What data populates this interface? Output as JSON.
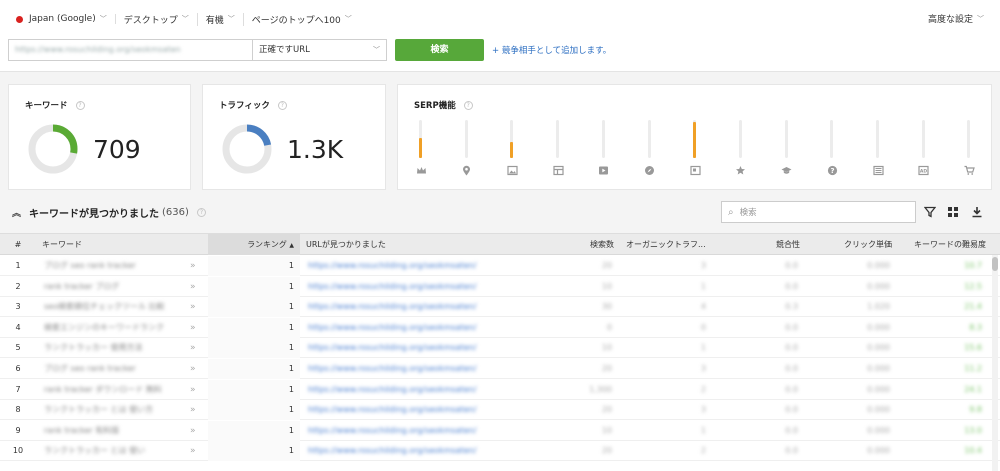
{
  "filters": [
    {
      "label": "Japan (Google)",
      "has_flag": true
    },
    {
      "label": "デスクトップ"
    },
    {
      "label": "有機"
    },
    {
      "label": "ページのトップへ100"
    }
  ],
  "advanced_settings": "高度な設定",
  "url_input": {
    "value": "https://www.rosuchilding.org/seokmsaten"
  },
  "match_mode": "正確ですURL",
  "search_button": "検索",
  "add_competitor": "+ 競争相手として追加します。",
  "cards": {
    "keywords": {
      "title": "キーワード",
      "value": "709",
      "fraction": 0.28,
      "color": "#5aaa35"
    },
    "traffic": {
      "title": "トラフィック",
      "value": "1.3K",
      "fraction": 0.22,
      "color": "#4a7fc1"
    },
    "serp": {
      "title": "SERP機能",
      "features": [
        {
          "icon": "crown-icon",
          "level": 0.55
        },
        {
          "icon": "map-pin-icon",
          "level": 0
        },
        {
          "icon": "image-icon",
          "level": 0.45
        },
        {
          "icon": "layout-icon",
          "level": 0
        },
        {
          "icon": "video-icon",
          "level": 0
        },
        {
          "icon": "compass-icon",
          "level": 0
        },
        {
          "icon": "featured-snippet-icon",
          "level": 1.0
        },
        {
          "icon": "star-icon",
          "level": 0
        },
        {
          "icon": "graduation-cap-icon",
          "level": 0
        },
        {
          "icon": "question-icon",
          "level": 0
        },
        {
          "icon": "news-icon",
          "level": 0
        },
        {
          "icon": "ad-icon",
          "level": 0
        },
        {
          "icon": "shopping-cart-icon",
          "level": 0
        }
      ],
      "accent": "#f0a026"
    }
  },
  "results": {
    "title": "キーワードが見つかりました",
    "count": "(636)",
    "search_placeholder": "検索"
  },
  "table": {
    "columns": {
      "index": "#",
      "keyword": "キーワード",
      "ranking": "ランキング",
      "url": "URLが見つかりました",
      "volume": "検索数",
      "traffic": "オーガニックトラフ...",
      "competition": "競合性",
      "cpc": "クリック単価",
      "difficulty": "キーワードの難易度"
    },
    "rows": [
      {
        "n": "1",
        "kw": "ブログ seo rank tracker",
        "rank": "1",
        "url": "https://www.rosuchilding.org/seokmsaten/",
        "vol": "20",
        "traffic": "3",
        "comp": "0.0",
        "cpc": "0.000",
        "diff": "10.7"
      },
      {
        "n": "2",
        "kw": "rank tracker ブログ",
        "rank": "1",
        "url": "https://www.rosuchilding.org/seokmsaten/",
        "vol": "10",
        "traffic": "1",
        "comp": "0.0",
        "cpc": "0.000",
        "diff": "12.5"
      },
      {
        "n": "3",
        "kw": "seo検索順位チェックツール 比較",
        "rank": "1",
        "url": "https://www.rosuchilding.org/seokmsaten/",
        "vol": "30",
        "traffic": "4",
        "comp": "0.3",
        "cpc": "1.020",
        "diff": "21.4"
      },
      {
        "n": "4",
        "kw": "検索エンジンのキーワードランク",
        "rank": "1",
        "url": "https://www.rosuchilding.org/seokmsaten/",
        "vol": "0",
        "traffic": "0",
        "comp": "0.0",
        "cpc": "0.000",
        "diff": "8.3"
      },
      {
        "n": "5",
        "kw": "ランクトラッカー 使用方法",
        "rank": "1",
        "url": "https://www.rosuchilding.org/seokmsaten/",
        "vol": "10",
        "traffic": "1",
        "comp": "0.0",
        "cpc": "0.000",
        "diff": "15.6"
      },
      {
        "n": "6",
        "kw": "ブログ seo rank tracker",
        "rank": "1",
        "url": "https://www.rosuchilding.org/seokmsaten/",
        "vol": "20",
        "traffic": "3",
        "comp": "0.0",
        "cpc": "0.000",
        "diff": "11.2"
      },
      {
        "n": "7",
        "kw": "rank tracker ダウンロード 無料",
        "rank": "1",
        "url": "https://www.rosuchilding.org/seokmsaten/",
        "vol": "1,300",
        "traffic": "2",
        "comp": "0.0",
        "cpc": "0.000",
        "diff": "24.1"
      },
      {
        "n": "8",
        "kw": "ランクトラッカー とは 使い方",
        "rank": "1",
        "url": "https://www.rosuchilding.org/seokmsaten/",
        "vol": "20",
        "traffic": "3",
        "comp": "0.0",
        "cpc": "0.000",
        "diff": "9.8"
      },
      {
        "n": "9",
        "kw": "rank tracker 有料版",
        "rank": "1",
        "url": "https://www.rosuchilding.org/seokmsaten/",
        "vol": "10",
        "traffic": "1",
        "comp": "0.0",
        "cpc": "0.000",
        "diff": "13.0"
      },
      {
        "n": "10",
        "kw": "ランクトラッカー とは 使い",
        "rank": "1",
        "url": "https://www.rosuchilding.org/seokmsaten/",
        "vol": "20",
        "traffic": "2",
        "comp": "0.0",
        "cpc": "0.000",
        "diff": "10.4"
      }
    ]
  }
}
